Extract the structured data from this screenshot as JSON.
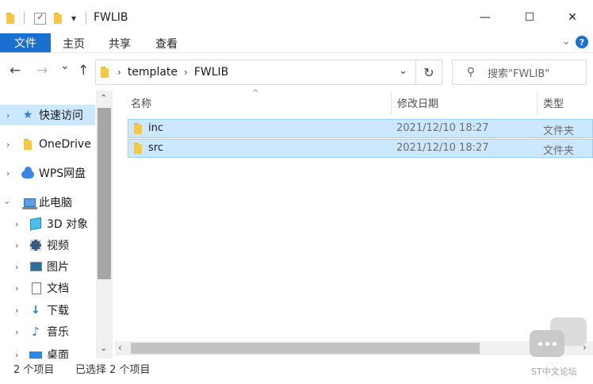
{
  "window": {
    "title": "FWLIB",
    "quick_access_dropdown": "▾",
    "minimize": "—",
    "maximize": "☐",
    "close": "✕"
  },
  "ribbon": {
    "tabs": [
      {
        "label": "文件",
        "active": true
      },
      {
        "label": "主页"
      },
      {
        "label": "共享"
      },
      {
        "label": "查看"
      }
    ],
    "expand_icon": "chevron-down-icon",
    "help": "?"
  },
  "navigation": {
    "back": "←",
    "forward": "→",
    "recent": "⌄",
    "up": "↑",
    "breadcrumb": [
      "template",
      "FWLIB"
    ],
    "refresh": "↻",
    "search_placeholder": "搜索\"FWLIB\""
  },
  "nav_pane": {
    "items": [
      {
        "label": "快速访问",
        "icon": "quick-access-star-icon",
        "level": 0,
        "expanded": false,
        "selected": true
      },
      {
        "label": "OneDrive",
        "icon": "onedrive-folder-icon",
        "level": 0,
        "expanded": false
      },
      {
        "label": "WPS网盘",
        "icon": "cloud-icon",
        "level": 0,
        "expanded": false
      },
      {
        "label": "此电脑",
        "icon": "computer-icon",
        "level": 0,
        "expanded": true
      },
      {
        "label": "3D 对象",
        "icon": "3d-objects-icon",
        "level": 1,
        "expanded": false
      },
      {
        "label": "视频",
        "icon": "videos-icon",
        "level": 1,
        "expanded": false
      },
      {
        "label": "图片",
        "icon": "pictures-icon",
        "level": 1,
        "expanded": false
      },
      {
        "label": "文档",
        "icon": "documents-icon",
        "level": 1,
        "expanded": false
      },
      {
        "label": "下载",
        "icon": "downloads-icon",
        "level": 1,
        "expanded": false
      },
      {
        "label": "音乐",
        "icon": "music-icon",
        "level": 1,
        "expanded": false
      },
      {
        "label": "桌面",
        "icon": "desktop-icon",
        "level": 1,
        "expanded": false
      }
    ]
  },
  "file_list": {
    "columns": [
      "名称",
      "修改日期",
      "类型"
    ],
    "sort_indicator": "^",
    "rows": [
      {
        "name": "inc",
        "modified": "2021/12/10 18:27",
        "type": "文件夹",
        "selected": true
      },
      {
        "name": "src",
        "modified": "2021/12/10 18:27",
        "type": "文件夹",
        "selected": true
      }
    ]
  },
  "status_bar": {
    "item_count": "2 个项目",
    "selection": "已选择 2 个项目"
  },
  "watermark": {
    "text": "ST中文论坛"
  },
  "colors": {
    "accent": "#1a6fd0",
    "selection_bg": "#cce8ff",
    "selection_border": "#99d1ff",
    "folder": "#f5c842"
  }
}
